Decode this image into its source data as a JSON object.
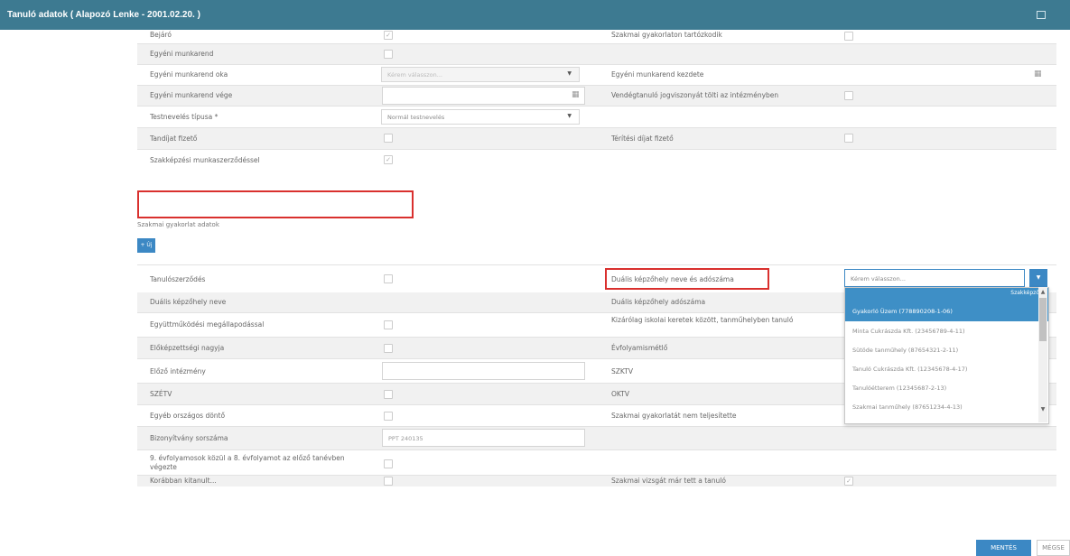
{
  "window": {
    "title": "Tanuló adatok ( Alapozó Lenke - 2001.02.20. )"
  },
  "rows": {
    "r0": {
      "left": "Bejáró",
      "right": "Szakmai gyakorlaton tartózkodik"
    },
    "r1": {
      "left": "Egyéni munkarend"
    },
    "r2": {
      "left": "Egyéni munkarend oka",
      "select": "Kérem válasszon...",
      "right": "Egyéni munkarend kezdete"
    },
    "r3": {
      "left": "Egyéni munkarend vége",
      "right": "Vendégtanuló jogviszonyát tölti az intézményben"
    },
    "r4": {
      "left": "Testnevelés típusa *",
      "select": "Normál testnevelés"
    },
    "r5": {
      "left": "Tandíjat fizető",
      "right": "Térítési díjat fizető"
    },
    "r6": {
      "left": "Szakképzési munkaszerződéssel"
    },
    "section": {
      "label": "Szakmai gyakorlat adatok",
      "add_button": "+ Új"
    },
    "r7": {
      "left": "Tanulószerződés",
      "right": "Duális képzőhely neve és adószáma",
      "select": "Kérem válasszon..."
    },
    "r8": {
      "left": "Duális képzőhely neve",
      "right": "Duális képzőhely adószáma"
    },
    "r9": {
      "left": "Együttműködési megállapodással",
      "right": "Kizárólag iskolai keretek között, tanműhelyben tanuló"
    },
    "r10": {
      "left": "Előképzettségi nagyja",
      "right": "Évfolyamismétlő"
    },
    "r11": {
      "left": "Előző intézmény",
      "right": "SZKTV"
    },
    "r12": {
      "left": "SZÉTV",
      "right": "OKTV"
    },
    "r13": {
      "left": "Egyéb országos döntő",
      "right": "Szakmai gyakorlatát nem teljesítette"
    },
    "r14": {
      "left": "Bizonyítvány sorszáma",
      "input": "PPT 240135"
    },
    "r15": {
      "left": "9. évfolyamosok közül a 8. évfolyamot az előző tanévben végezte"
    },
    "r16": {
      "left": "Korábban kitanult...",
      "right": "Szakmai vizsgát már tett a tanuló"
    }
  },
  "dropdown": {
    "group": "Szakképző",
    "options": [
      "Gyakorló Üzem (778890208-1-06)",
      "Minta Cukrászda Kft. (23456789-4-11)",
      "Sütöde tanműhely (87654321-2-11)",
      "Tanuló Cukrászda Kft. (12345678-4-17)",
      "Tanulóétterem (12345687-2-13)",
      "Szakmai tanműhely (87651234-4-13)"
    ]
  },
  "footer": {
    "save": "MENTÉS",
    "cancel": "MÉGSE"
  },
  "colors": {
    "titlebar": "#3d7a91",
    "primary": "#3c88c4",
    "highlight": "#d9302e"
  }
}
